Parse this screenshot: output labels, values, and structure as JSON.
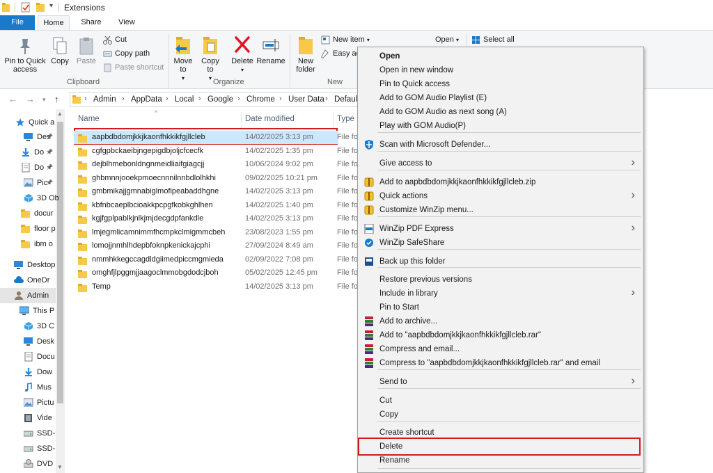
{
  "window": {
    "title": "Extensions"
  },
  "ribbon_tabs": [
    "File",
    "Home",
    "Share",
    "View"
  ],
  "ribbon": {
    "pin_quick_access": "Pin to Quick access",
    "copy": "Copy",
    "paste": "Paste",
    "cut": "Cut",
    "copy_path": "Copy path",
    "paste_shortcut": "Paste shortcut",
    "clipboard_group": "Clipboard",
    "move_to": "Move to",
    "copy_to": "Copy to",
    "delete": "Delete",
    "rename": "Rename",
    "organize_group": "Organize",
    "new_folder": "New folder",
    "new_item": "New item",
    "easy_access": "Easy ac",
    "new_group": "New",
    "open": "Open",
    "select_all": "Select all"
  },
  "address": {
    "crumbs": [
      "Admin",
      "AppData",
      "Local",
      "Google",
      "Chrome",
      "User Data",
      "Defaul"
    ]
  },
  "nav": {
    "items": [
      {
        "label": "Quick a",
        "icon": "star-icon"
      },
      {
        "label": "Des",
        "icon": "desktop-icon"
      },
      {
        "label": "Do",
        "icon": "download-icon"
      },
      {
        "label": "Do",
        "icon": "document-icon"
      },
      {
        "label": "Pic",
        "icon": "pictures-icon"
      },
      {
        "label": "3D Ob",
        "icon": "3d-objects-icon"
      },
      {
        "label": "docur",
        "icon": "folder-icon"
      },
      {
        "label": "floor p",
        "icon": "folder-icon"
      },
      {
        "label": "ibm o",
        "icon": "folder-icon"
      },
      {
        "label": "Desktop",
        "icon": "desktop-icon"
      },
      {
        "label": "OneDr",
        "icon": "cloud-icon"
      },
      {
        "label": "Admin",
        "icon": "user-icon"
      },
      {
        "label": "This P",
        "icon": "computer-icon"
      },
      {
        "label": "3D C",
        "icon": "3d-objects-icon"
      },
      {
        "label": "Desk",
        "icon": "desktop-icon"
      },
      {
        "label": "Docu",
        "icon": "document-icon"
      },
      {
        "label": "Dow",
        "icon": "download-icon"
      },
      {
        "label": "Mus",
        "icon": "music-icon"
      },
      {
        "label": "Pictu",
        "icon": "pictures-icon"
      },
      {
        "label": "Vide",
        "icon": "video-icon"
      },
      {
        "label": "SSD-",
        "icon": "drive-icon"
      },
      {
        "label": "SSD-",
        "icon": "drive-icon"
      },
      {
        "label": "DVD",
        "icon": "dvd-icon"
      }
    ]
  },
  "columns": {
    "name": "Name",
    "date": "Date modified",
    "type": "Type"
  },
  "files": [
    {
      "name": "aapbdbdomjkkjkaonfhkkikfgjllcleb",
      "date": "14/02/2025 3:13 pm",
      "type": "File fo"
    },
    {
      "name": "cgfgpbckaeibjngepigdbjoljcfcecfk",
      "date": "14/02/2025 1:35 pm",
      "type": "File fo"
    },
    {
      "name": "dejblhmebonldngnmeidliaifgiagcjj",
      "date": "10/06/2024 9:02 pm",
      "type": "File fo"
    },
    {
      "name": "ghbmnnjooekpmoecnnnilnnbdlolhkhi",
      "date": "09/02/2025 10:21 pm",
      "type": "File fo"
    },
    {
      "name": "gmbmikajjgmnabiglmofipeabaddhgne",
      "date": "14/02/2025 3:13 pm",
      "type": "File fo"
    },
    {
      "name": "kbfnbcaeplbcioakkpcpgfkobkghlhen",
      "date": "14/02/2025 1:40 pm",
      "type": "File fo"
    },
    {
      "name": "kgjfgplpablkjnlkjmjdecgdpfankdle",
      "date": "14/02/2025 3:13 pm",
      "type": "File fo"
    },
    {
      "name": "lmjegmlicamnimmfhcmpkclmigmmcbeh",
      "date": "23/08/2023 1:55 pm",
      "type": "File fo"
    },
    {
      "name": "lomojjnmhlhdepbfoknpkenickajcphi",
      "date": "27/09/2024 8:49 am",
      "type": "File fo"
    },
    {
      "name": "nmmhkkegccagdldgiimedpiccmgmieda",
      "date": "02/09/2022 7:08 pm",
      "type": "File fo"
    },
    {
      "name": "omghfjlpggmjjaagoclmmobgdodcjboh",
      "date": "05/02/2025 12:45 pm",
      "type": "File fo"
    },
    {
      "name": "Temp",
      "date": "14/02/2025 3:13 pm",
      "type": "File fo"
    }
  ],
  "context_menu": {
    "items": [
      {
        "label": "Open",
        "bold": true
      },
      {
        "label": "Open in new window"
      },
      {
        "label": "Pin to Quick access"
      },
      {
        "label": "Add to GOM Audio Playlist (E)"
      },
      {
        "label": "Add to GOM Audio as next song (A)"
      },
      {
        "label": "Play with GOM Audio(P)"
      },
      {
        "label": "Scan with Microsoft Defender...",
        "icon": "defender-shield-icon"
      },
      {
        "label": "Give access to",
        "submenu": true
      },
      {
        "label": "Add to aapbdbdomjkkjkaonfhkkikfgjllcleb.zip",
        "icon": "winzip-icon"
      },
      {
        "label": "Quick actions",
        "icon": "winzip-icon",
        "submenu": true
      },
      {
        "label": "Customize WinZip menu...",
        "icon": "winzip-icon"
      },
      {
        "label": "WinZip PDF Express",
        "icon": "pdf-icon",
        "submenu": true
      },
      {
        "label": "WinZip SafeShare",
        "icon": "safeshare-icon"
      },
      {
        "label": "Back up this folder",
        "icon": "backup-icon"
      },
      {
        "label": "Restore previous versions"
      },
      {
        "label": "Include in library",
        "submenu": true
      },
      {
        "label": "Pin to Start"
      },
      {
        "label": "Add to archive...",
        "icon": "winrar-icon"
      },
      {
        "label": "Add to \"aapbdbdomjkkjkaonfhkkikfgjllcleb.rar\"",
        "icon": "winrar-icon"
      },
      {
        "label": "Compress and email...",
        "icon": "winrar-icon"
      },
      {
        "label": "Compress to \"aapbdbdomjkkjkaonfhkkikfgjllcleb.rar\" and email",
        "icon": "winrar-icon"
      },
      {
        "label": "Send to",
        "submenu": true
      },
      {
        "label": "Cut"
      },
      {
        "label": "Copy"
      },
      {
        "label": "Create shortcut"
      },
      {
        "label": "Delete"
      },
      {
        "label": "Rename"
      }
    ]
  },
  "colors": {
    "accent": "#1979ca",
    "selection": "#cce8ff",
    "highlight_box": "#d41b1b",
    "menu_bg": "#f2f2f2"
  }
}
